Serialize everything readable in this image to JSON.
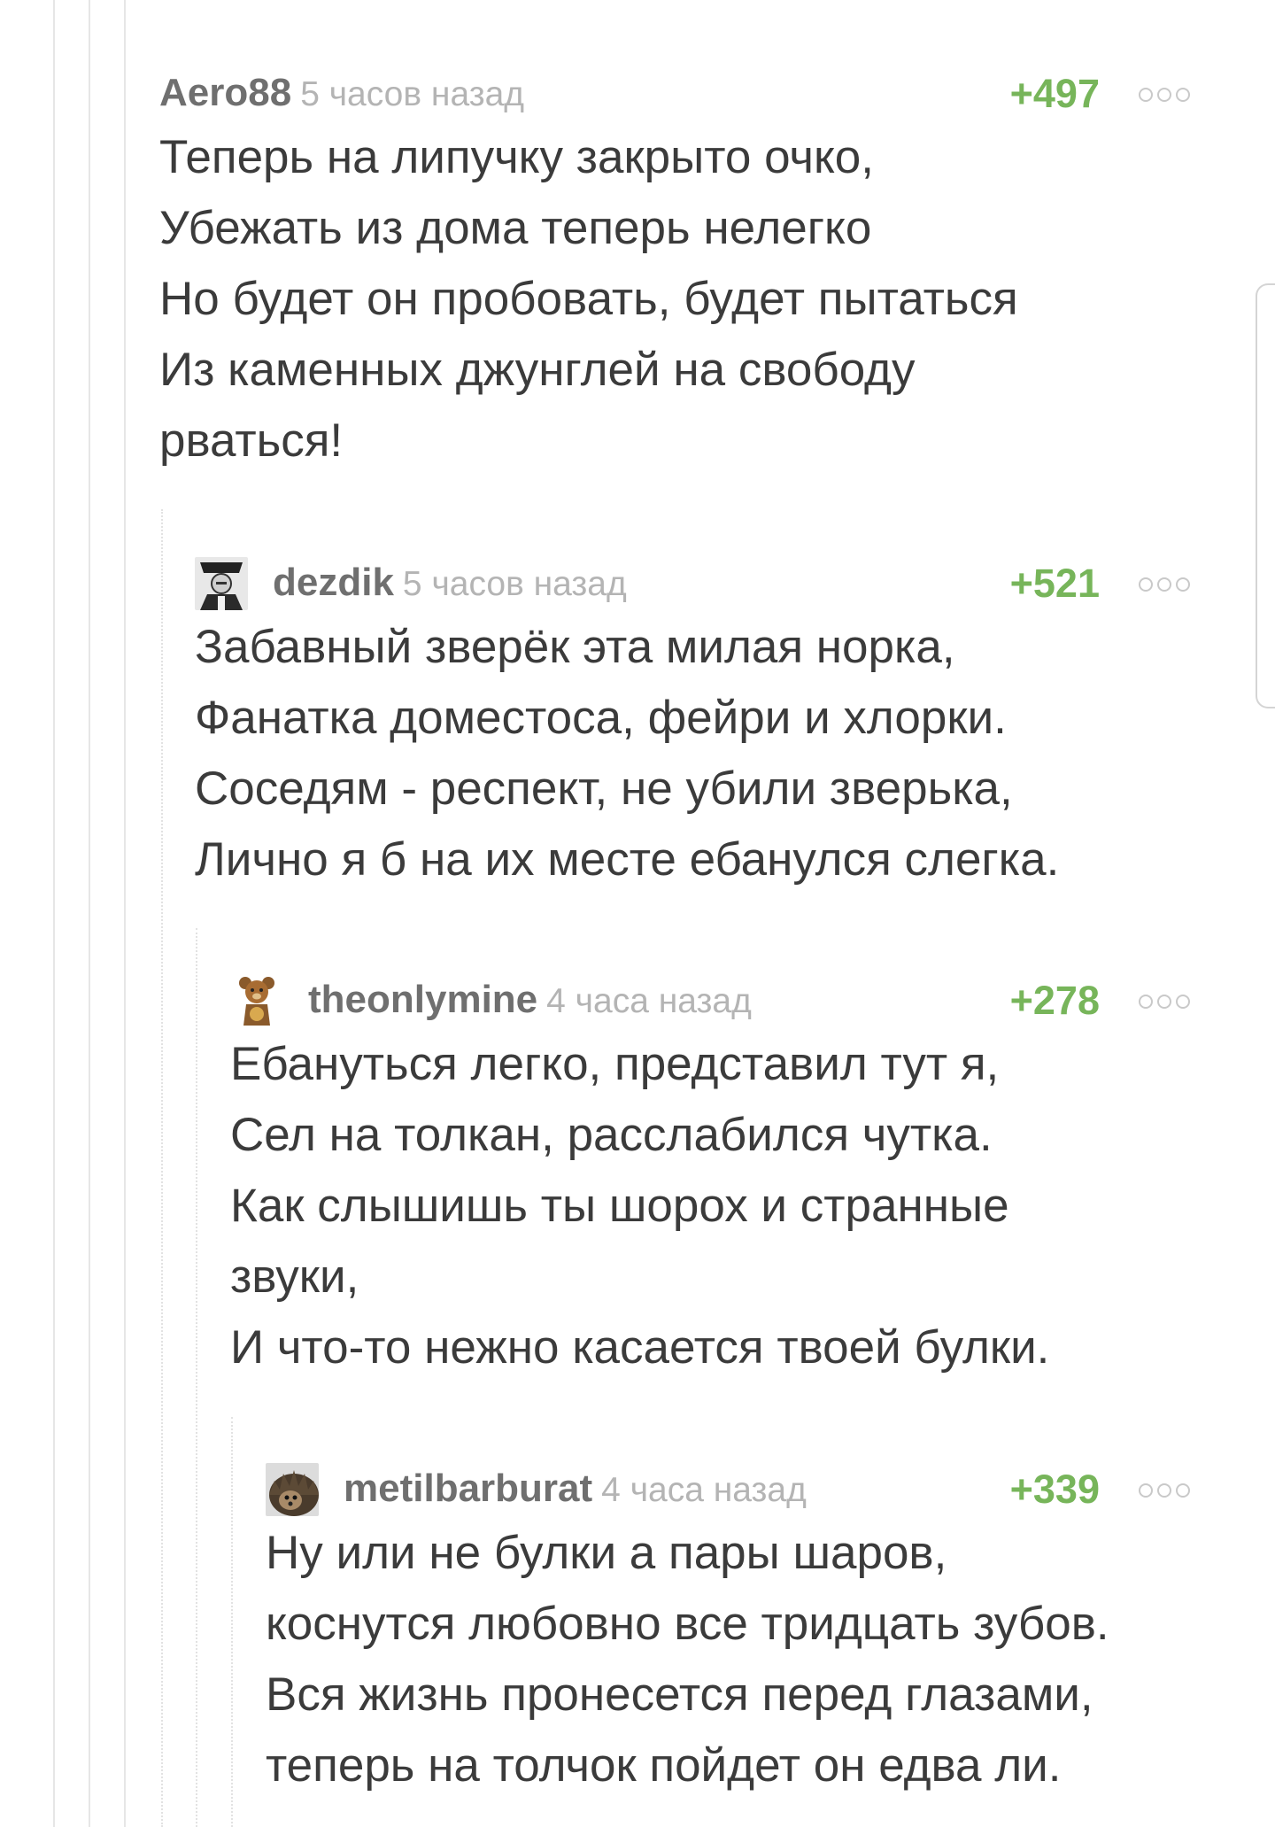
{
  "comments": [
    {
      "author": "Aero88",
      "time": "5 часов назад",
      "rating": "+497",
      "avatar": "none",
      "lines": [
        "Теперь на липучку закрыто очко,",
        "Убежать из дома теперь нелегко",
        "Но будет он пробовать, будет пытаться",
        "Из каменных джунглей на свободу",
        "рваться!"
      ]
    },
    {
      "author": "dezdik",
      "time": "5 часов назад",
      "rating": "+521",
      "avatar": "photo-avatar",
      "lines": [
        "Забавный зверёк эта милая норка,",
        "Фанатка доместоса, фейри и хлорки.",
        "Соседям - респект, не убили зверька,",
        "Лично я б на их месте ебанулся слегка."
      ]
    },
    {
      "author": "theonlymine",
      "time": "4 часа назад",
      "rating": "+278",
      "avatar": "teddy-bear-avatar",
      "lines": [
        "Ебануться легко, представил тут я,",
        "Сел на толкан, расслабился чутка.",
        "Как слышишь ты шорох и странные",
        "звуки,",
        "И что-то нежно касается твоей булки."
      ]
    },
    {
      "author": "metilbarburat",
      "time": "4 часа назад",
      "rating": "+339",
      "avatar": "hedgehog-avatar",
      "lines": [
        "Ну или не булки а пары шаров,",
        "коснутся любовно все тридцать зубов.",
        "Вся жизнь пронесется перед глазами,",
        "теперь на толчок пойдет он едва ли."
      ]
    }
  ],
  "colors": {
    "rating": "#77b55a",
    "author": "#6f6f6f",
    "time": "#b4b4b4",
    "text": "#3b3b3b"
  }
}
